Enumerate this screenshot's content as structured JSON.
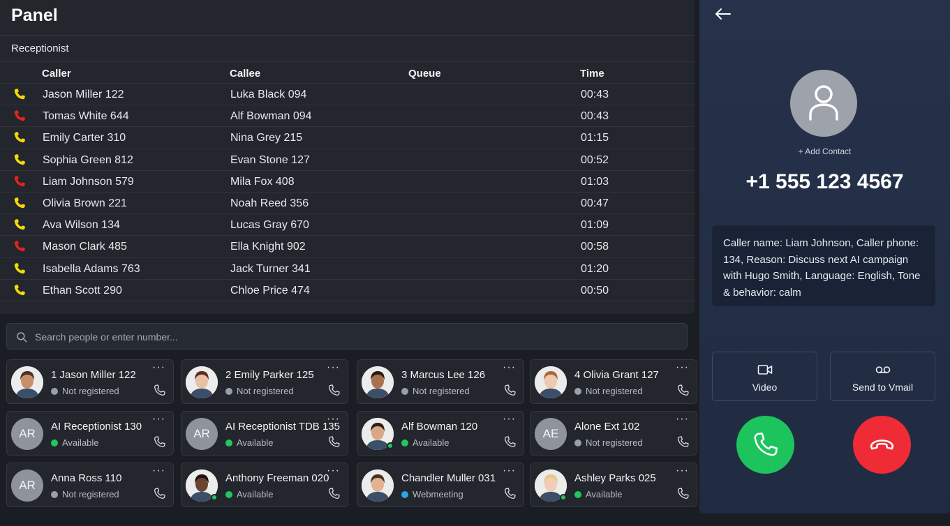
{
  "panel": {
    "title": "Panel",
    "section": "Receptionist",
    "columns": [
      "Caller",
      "Callee",
      "Queue",
      "Time"
    ],
    "rows": [
      {
        "caller": "Jason Miller 122",
        "callee": "Luka Black 094",
        "queue": "",
        "time": "00:43",
        "icon_color": "#f5d90a"
      },
      {
        "caller": "Tomas White 644",
        "callee": "Alf Bowman 094",
        "queue": "",
        "time": "00:43",
        "icon_color": "#e5231b"
      },
      {
        "caller": "Emily Carter 310",
        "callee": "Nina Grey 215",
        "queue": "",
        "time": "01:15",
        "icon_color": "#f5d90a"
      },
      {
        "caller": "Sophia Green 812",
        "callee": "Evan Stone 127",
        "queue": "",
        "time": "00:52",
        "icon_color": "#f5d90a"
      },
      {
        "caller": "Liam Johnson 579",
        "callee": "Mila Fox 408",
        "queue": "",
        "time": "01:03",
        "icon_color": "#e5231b"
      },
      {
        "caller": "Olivia Brown 221",
        "callee": "Noah Reed 356",
        "queue": "",
        "time": "00:47",
        "icon_color": "#f5d90a"
      },
      {
        "caller": "Ava Wilson 134",
        "callee": "Lucas Gray 670",
        "queue": "",
        "time": "01:09",
        "icon_color": "#f5d90a"
      },
      {
        "caller": "Mason Clark 485",
        "callee": "Ella Knight 902",
        "queue": "",
        "time": "00:58",
        "icon_color": "#e5231b"
      },
      {
        "caller": "Isabella Adams 763",
        "callee": "Jack Turner 341",
        "queue": "",
        "time": "01:20",
        "icon_color": "#f5d90a"
      },
      {
        "caller": "Ethan Scott 290",
        "callee": "Chloe Price 474",
        "queue": "",
        "time": "00:50",
        "icon_color": "#f5d90a"
      }
    ]
  },
  "search": {
    "placeholder": "Search people or enter number..."
  },
  "contacts": [
    {
      "name": "1 Jason Miller 122",
      "status": "Not registered",
      "status_color": "#9aa0a9",
      "avatar": "photo",
      "skin": "#c98e6a",
      "hair": "#4a3424"
    },
    {
      "name": "2 Emily Parker 125",
      "status": "Not registered",
      "status_color": "#9aa0a9",
      "avatar": "photo",
      "skin": "#e8c0a4",
      "hair": "#5a2f1d"
    },
    {
      "name": "3 Marcus Lee 126",
      "status": "Not registered",
      "status_color": "#9aa0a9",
      "avatar": "photo",
      "skin": "#a9714e",
      "hair": "#2b1d15"
    },
    {
      "name": "4 Olivia Grant 127",
      "status": "Not registered",
      "status_color": "#9aa0a9",
      "avatar": "photo",
      "skin": "#efc9ad",
      "hair": "#a7683a"
    },
    {
      "name": "AI Receptionist 130",
      "status": "Available",
      "status_color": "#22c55e",
      "avatar": "initials",
      "initials": "AR"
    },
    {
      "name": "AI Receptionist TDB 135",
      "status": "Available",
      "status_color": "#22c55e",
      "avatar": "initials",
      "initials": "AR"
    },
    {
      "name": "Alf Bowman 120",
      "status": "Available",
      "status_color": "#22c55e",
      "avatar": "photo",
      "skin": "#d9a783",
      "hair": "#2d211a",
      "presence": true
    },
    {
      "name": "Alone Ext 102",
      "status": "Not registered",
      "status_color": "#9aa0a9",
      "avatar": "initials",
      "initials": "AE"
    },
    {
      "name": "Anna Ross 110",
      "status": "Not registered",
      "status_color": "#9aa0a9",
      "avatar": "initials",
      "initials": "AR"
    },
    {
      "name": "Anthony Freeman 020",
      "status": "Available",
      "status_color": "#22c55e",
      "avatar": "photo",
      "skin": "#6b4430",
      "hair": "#1d1410",
      "presence": true
    },
    {
      "name": "Chandler Muller 031",
      "status": "Webmeeting",
      "status_color": "#2aa7e8",
      "avatar": "photo",
      "skin": "#e2b292",
      "hair": "#4a3322"
    },
    {
      "name": "Ashley Parks 025",
      "status": "Available",
      "status_color": "#22c55e",
      "avatar": "photo",
      "skin": "#f0cdb4",
      "hair": "#e3c98a",
      "presence": true
    }
  ],
  "call": {
    "add_contact": "+ Add Contact",
    "number": "+1 555 123 4567",
    "info": "Caller name: Liam Johnson, Caller phone: 134, Reason: Discuss next AI campaign with Hugo Smith, Language: English, Tone & behavior: calm",
    "video_label": "Video",
    "vmail_label": "Send to Vmail",
    "answer_color": "#1dc45e",
    "decline_color": "#ef2b35"
  }
}
